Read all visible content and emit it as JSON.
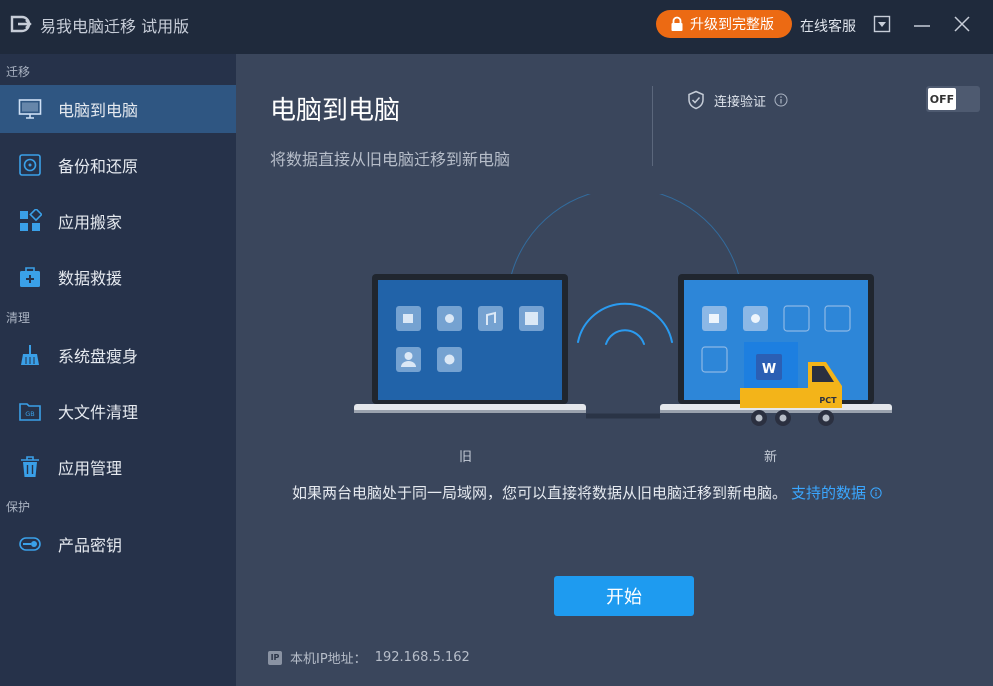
{
  "titlebar": {
    "app_title": "易我电脑迁移 试用版",
    "upgrade_label": "升级到完整版",
    "support_label": "在线客服"
  },
  "sidebar": {
    "sections": [
      "迁移",
      "清理",
      "保护"
    ],
    "items": [
      {
        "label": "电脑到电脑",
        "icon": "monitor-icon",
        "active": true
      },
      {
        "label": "备份和还原",
        "icon": "disk-backup-icon"
      },
      {
        "label": "应用搬家",
        "icon": "apps-grid-icon"
      },
      {
        "label": "数据救援",
        "icon": "rescue-kit-icon"
      },
      {
        "label": "系统盘瘦身",
        "icon": "broom-icon"
      },
      {
        "label": "大文件清理",
        "icon": "gb-folder-icon"
      },
      {
        "label": "应用管理",
        "icon": "trash-icon"
      },
      {
        "label": "产品密钥",
        "icon": "key-icon"
      }
    ]
  },
  "main": {
    "title": "电脑到电脑",
    "subtitle": "将数据直接从旧电脑迁移到新电脑",
    "verify_label": "连接验证",
    "toggle_state": "OFF",
    "old_label": "旧",
    "new_label": "新",
    "truck_text": "PCT",
    "info_text": "如果两台电脑处于同一局域网，您可以直接将数据从旧电脑迁移到新电脑。",
    "info_link": "支持的数据",
    "start_label": "开始",
    "ip_label": "本机IP地址：",
    "ip_value": "192.168.5.162"
  },
  "colors": {
    "accent_orange": "#ec6a13",
    "accent_blue": "#1e9bf0",
    "link_blue": "#3aa7ff",
    "sidebar_active": "#2f5682"
  }
}
